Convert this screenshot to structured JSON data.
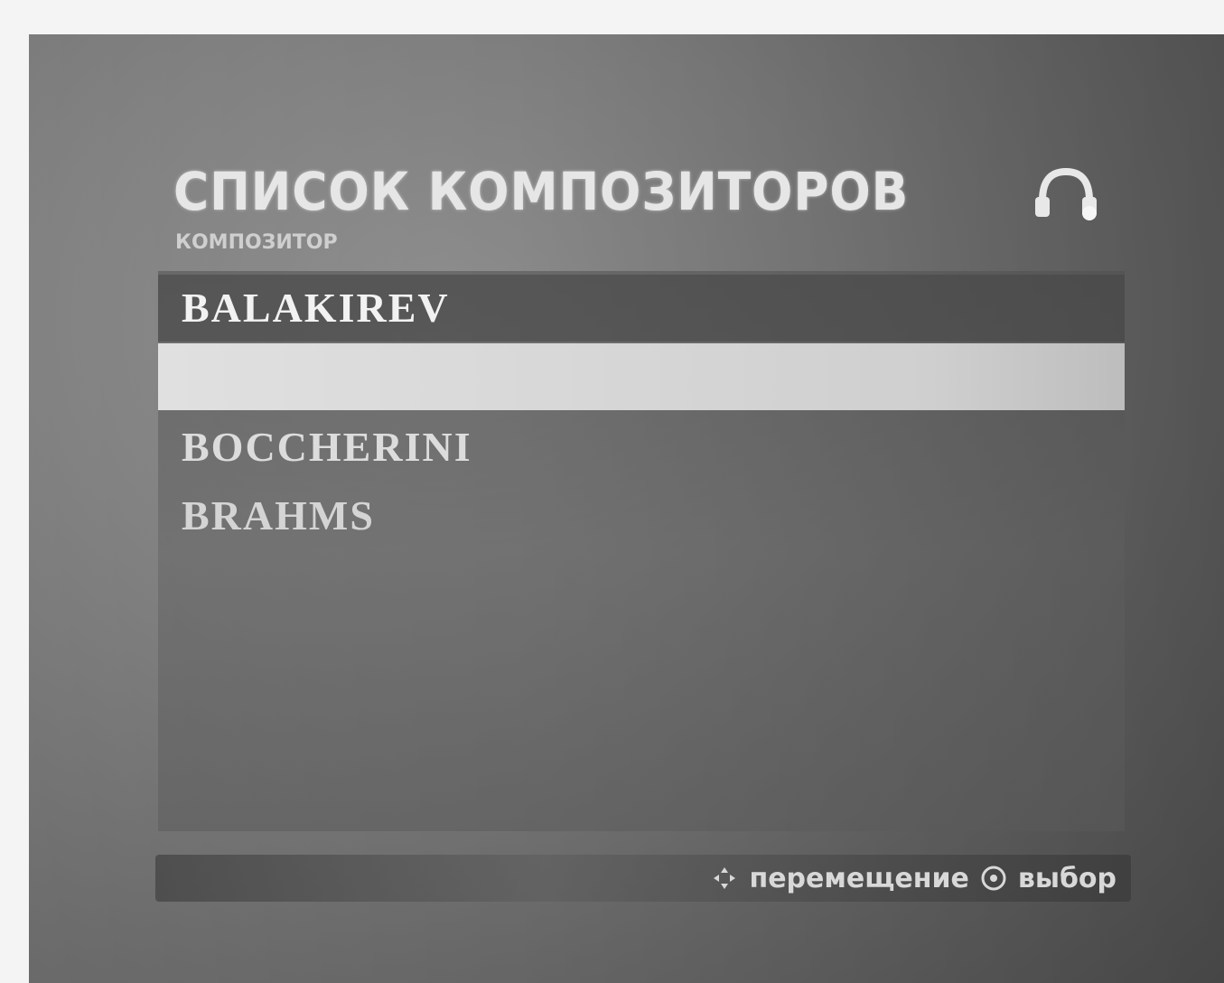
{
  "header": {
    "title": "СПИСОК КОМПОЗИТОРОВ",
    "subtitle": "КОМПОЗИТОР",
    "icon": "music-note-icon"
  },
  "list": {
    "items": [
      {
        "label": "BALAKIREV"
      },
      {
        "label": ""
      },
      {
        "label": "BOCCHERINI"
      },
      {
        "label": "BRAHMS"
      }
    ],
    "selected_index": 1
  },
  "footer": {
    "move_icon": "dpad-icon",
    "move_label": "перемещение",
    "select_icon": "enter-button-icon",
    "select_label": "выбор"
  }
}
